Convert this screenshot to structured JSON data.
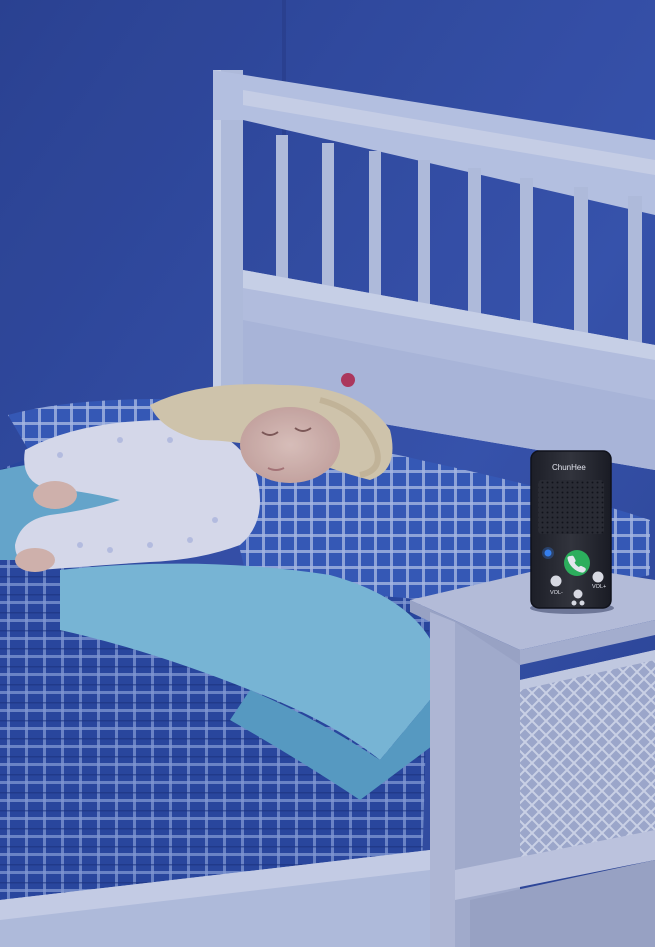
{
  "device": {
    "brand": "ChunHee",
    "vol_minus_label": "VOL-",
    "vol_plus_label": "VOL+"
  },
  "icons": {
    "call": "phone-call-icon",
    "indicator": "status-light-icon"
  },
  "colors": {
    "wall": "#3550a8",
    "wall_dark": "#253c8a",
    "bed_frame": "#c9d4ef",
    "bedding_blue": "#2f4fa6",
    "blanket": "#7fc3dd",
    "table": "#c8cfe6",
    "device_body": "#2a2a2a",
    "call_button": "#2fc15a",
    "indicator_light": "#3a8bff"
  }
}
